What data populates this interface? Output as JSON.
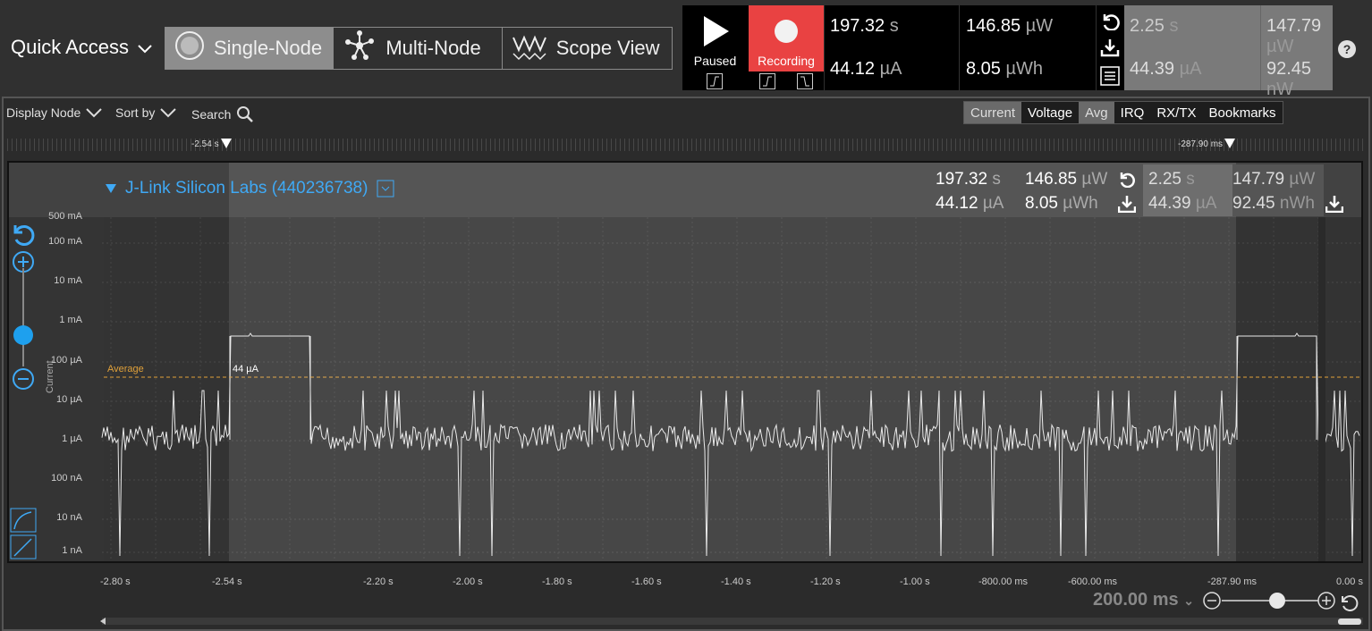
{
  "header": {
    "quick_access": "Quick Access",
    "modes": [
      "Single-Node",
      "Multi-Node",
      "Scope View"
    ]
  },
  "control": {
    "paused_label": "Paused",
    "recording_label": "Recording"
  },
  "stats_live": {
    "time_val": "197.32",
    "time_unit": "s",
    "power_val": "146.85",
    "power_unit": "µW",
    "current_val": "44.12",
    "current_unit": "µA",
    "energy_val": "8.05",
    "energy_unit": "µWh"
  },
  "stats_sel": {
    "time_val": "2.25",
    "time_unit": "s",
    "power_val": "147.79",
    "power_unit": "µW",
    "current_val": "44.39",
    "current_unit": "µA",
    "energy_val": "92.45",
    "energy_unit": "nW"
  },
  "toolbar": {
    "display_node": "Display Node",
    "sort_by": "Sort by",
    "search": "Search",
    "tabs": [
      "Current",
      "Voltage",
      "Avg",
      "IRQ",
      "RX/TX",
      "Bookmarks"
    ]
  },
  "markers": {
    "left": "-2.54 s",
    "right": "-287.90 ms"
  },
  "node": {
    "name": "J-Link Silicon Labs (440236738)",
    "time_val": "197.32",
    "time_unit": "s",
    "power_val": "146.85",
    "power_unit": "µW",
    "current_val": "44.12",
    "current_unit": "µA",
    "energy_val": "8.05",
    "energy_unit": "µWh",
    "sel_time_val": "2.25",
    "sel_time_unit": "s",
    "sel_power_val": "147.79",
    "sel_power_unit": "µW",
    "sel_current_val": "44.39",
    "sel_current_unit": "µA",
    "sel_energy_val": "92.45",
    "sel_energy_unit": "nWh"
  },
  "chart_data": {
    "type": "line",
    "ylabel": "Current",
    "yticks": [
      "500 mA",
      "100 mA",
      "10 mA",
      "1 mA",
      "100 µA",
      "10 µA",
      "1 µA",
      "100 nA",
      "10 nA",
      "1 nA"
    ],
    "xticks": [
      "-2.80 s",
      "-2.54 s",
      "-2.20 s",
      "-2.00 s",
      "-1.80 s",
      "-1.60 s",
      "-1.40 s",
      "-1.20 s",
      "-1.00 s",
      "-800.00 ms",
      "-600.00 ms",
      "-287.90 ms",
      "0.00 s"
    ],
    "average_label": "Average",
    "average_value": "44 µA",
    "y_log_scale": true,
    "baseline_current": "1 µA",
    "plateau_current": "1 mA",
    "plateaus": [
      {
        "start_s": -2.54,
        "end_s": -2.36
      },
      {
        "start_s": -0.29,
        "end_s": -0.11
      }
    ],
    "selection": {
      "start_s": -2.54,
      "end_s": -0.2879
    }
  },
  "zoom": {
    "label": "200.00 ms"
  }
}
